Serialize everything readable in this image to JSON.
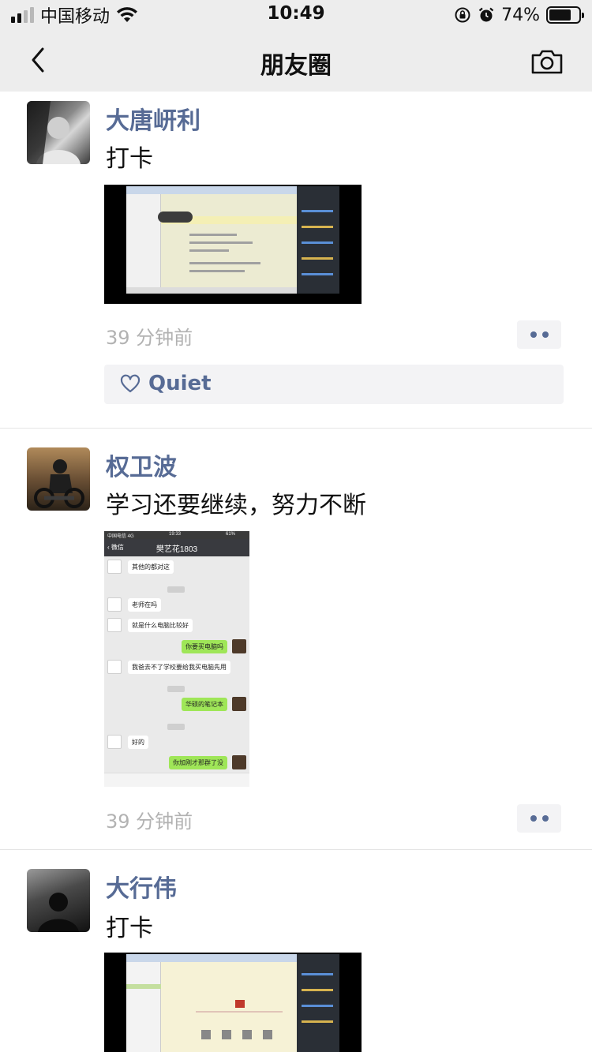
{
  "status_bar": {
    "carrier": "中国移动",
    "time": "10:49",
    "battery": "74%",
    "battery_level": 0.74
  },
  "nav": {
    "title": "朋友圈",
    "back_icon": "chevron-left-icon",
    "camera_icon": "camera-icon"
  },
  "posts": [
    {
      "username": "大唐岍利",
      "text": "打卡",
      "time": "39 分钟前",
      "likes": [
        "Quiet"
      ]
    },
    {
      "username": "权卫波",
      "text": "学习还要继续，努力不断",
      "time": "39 分钟前",
      "chat_screenshot": {
        "title": "樊艺花1803",
        "back": "微信",
        "status_carrier": "中国电信  4G",
        "status_time": "19:33",
        "status_battery": "61%",
        "messages": [
          {
            "side": "left",
            "text": "其他的都对这"
          },
          {
            "side": "left",
            "text": "老师在吗"
          },
          {
            "side": "left",
            "text": "就是什么电脑比较好"
          },
          {
            "side": "right",
            "text": "你要买电脑吗"
          },
          {
            "side": "left",
            "text": "我爸去不了学校要给我买电脑先用"
          },
          {
            "side": "right",
            "text": "华硕的笔记本"
          },
          {
            "side": "left",
            "text": "好的"
          },
          {
            "side": "right",
            "text": "你加刚才那群了没"
          }
        ]
      }
    },
    {
      "username": "大行伟",
      "text": "打卡"
    }
  ],
  "colors": {
    "bar_bg": "#ededed",
    "link": "#576b95",
    "meta": "#b2b2b2"
  }
}
